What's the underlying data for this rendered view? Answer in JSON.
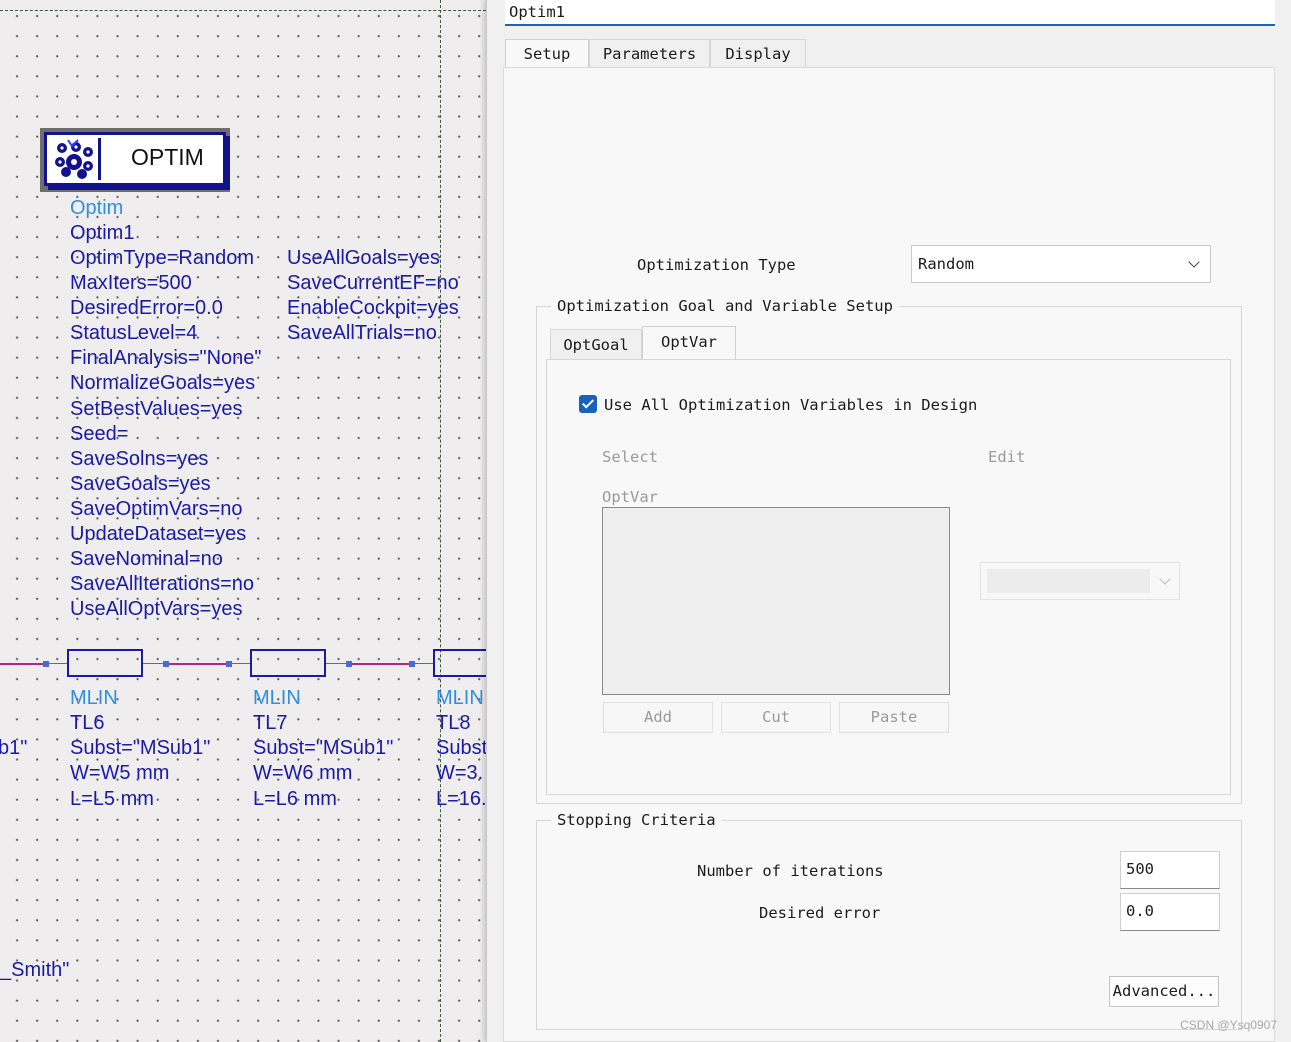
{
  "schematic": {
    "optim_component": {
      "symbol_label": "OPTIM",
      "type_label": "Optim",
      "instance_name": "Optim1",
      "params_col1": [
        "OptimType=Random",
        "MaxIters=500",
        "DesiredError=0.0",
        "StatusLevel=4",
        "FinalAnalysis=\"None\"",
        "NormalizeGoals=yes",
        "SetBestValues=yes",
        "Seed=",
        "SaveSolns=yes",
        "SaveGoals=yes",
        "SaveOptimVars=no",
        "UpdateDataset=yes",
        "SaveNominal=no",
        "SaveAllIterations=no",
        "UseAllOptVars=yes"
      ],
      "params_col2": [
        "UseAllGoals=yes",
        "SaveCurrentEF=no",
        "EnableCockpit=yes",
        "SaveAllTrials=no"
      ]
    },
    "mlines": [
      {
        "type": "MLIN",
        "name": "TL6",
        "subst": "Subst=\"MSub1\"",
        "w": "W=W5 mm",
        "l": "L=L5 mm"
      },
      {
        "type": "MLIN",
        "name": "TL7",
        "subst": "Subst=\"MSub1\"",
        "w": "W=W6 mm",
        "l": "L=L6 mm"
      },
      {
        "type": "MLIN",
        "name": "TL8",
        "subst": "Subst",
        "w": "W=3.",
        "l": "L=16."
      }
    ],
    "cutoff_left_text": "b1\"",
    "cutoff_smith_text": "_Smith\""
  },
  "dialog": {
    "instance_name_value": "Optim1",
    "tabs": [
      {
        "label": "Setup",
        "active": true
      },
      {
        "label": "Parameters"
      },
      {
        "label": "Display"
      }
    ],
    "optimization_type_label": "Optimization Type",
    "optimization_type_value": "Random",
    "goal_var_group_title": "Optimization Goal and Variable Setup",
    "inner_tabs": [
      {
        "label": "OptGoal"
      },
      {
        "label": "OptVar",
        "active": true
      }
    ],
    "use_all_vars_label": "Use All Optimization Variables in Design",
    "use_all_vars_checked": true,
    "select_label": "Select",
    "edit_label": "Edit",
    "optvar_list_label": "OptVar",
    "buttons": {
      "add": "Add",
      "cut": "Cut",
      "paste": "Paste"
    },
    "stopping_group_title": "Stopping Criteria",
    "iterations_label": "Number of iterations",
    "iterations_value": "500",
    "desired_error_label": "Desired error",
    "desired_error_value": "0.0",
    "advanced_button": "Advanced..."
  },
  "watermark": "CSDN @Ysq0907",
  "colors": {
    "schematic_text": "#1a1aa6",
    "component_type_text": "#2f8fe0",
    "wire": "#b2287e",
    "checkbox_accent": "#1662c0"
  }
}
